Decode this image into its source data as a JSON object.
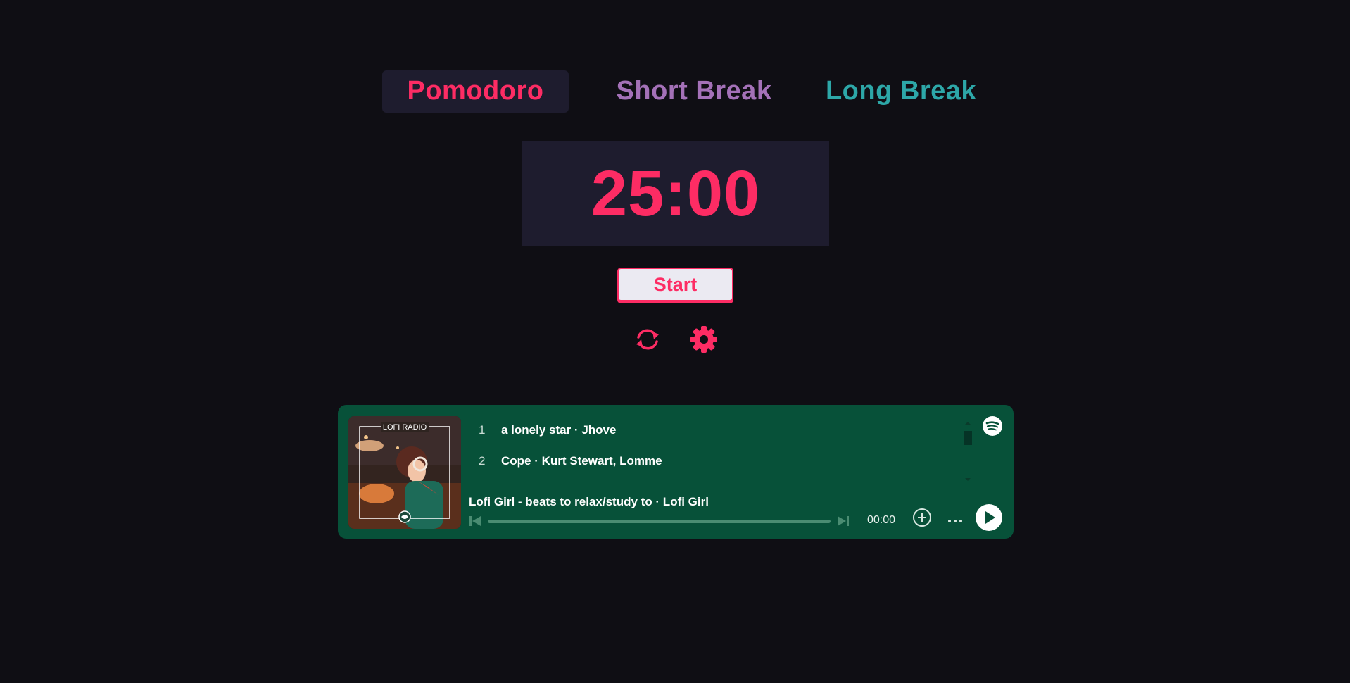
{
  "tabs": {
    "pomodoro": "Pomodoro",
    "short_break": "Short Break",
    "long_break": "Long Break"
  },
  "timer": {
    "display": "25:00"
  },
  "controls": {
    "start_label": "Start",
    "reset_icon": "refresh-icon",
    "settings_icon": "gear-icon"
  },
  "player": {
    "album_label": "LOFI RADIO",
    "tracks": [
      {
        "num": "1",
        "title": "a lonely star · Jhove"
      },
      {
        "num": "2",
        "title": "Cope · Kurt Stewart, Lomme"
      }
    ],
    "now_playing": "Lofi Girl - beats to relax/study to · Lofi Girl",
    "elapsed": "00:00",
    "progress": 0
  },
  "colors": {
    "accent": "#fd2c64",
    "short_break": "#a471b8",
    "long_break": "#2da7a8",
    "panel": "#1e1c2e",
    "background": "#0f0e14",
    "player_bg": "#075139"
  }
}
